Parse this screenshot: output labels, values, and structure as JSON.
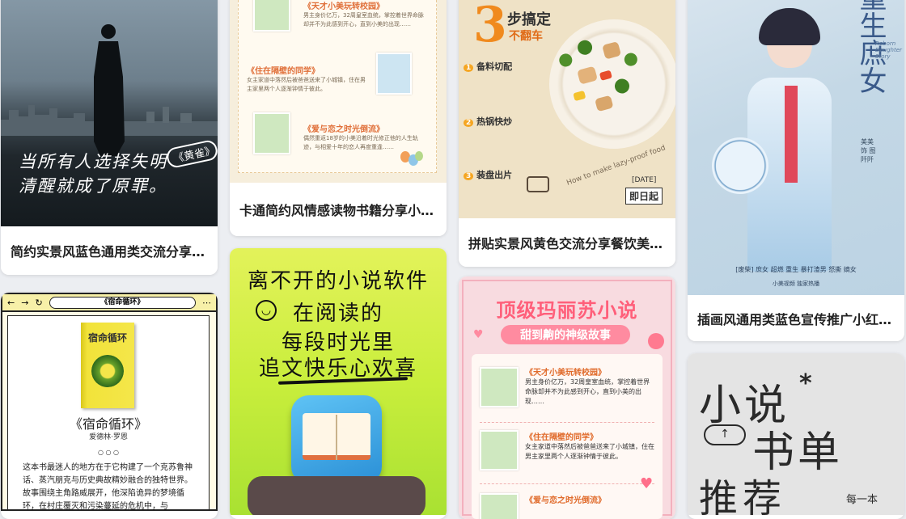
{
  "cards": [
    {
      "caption": "简约实景风蓝色通用类交流分享小红书配图",
      "overlay": {
        "line1": "当所有人选择失明",
        "line2": "清醒就成了原罪。",
        "tag": "《黄雀》"
      }
    },
    {
      "caption": "卡通简约风情感读物书籍分享小红书配图",
      "items": [
        {
          "title": "《天才小美玩转校园》",
          "text": "男主身价亿万，32周皇室血统，掌控着世界命脉却并不为此感到开心，直到小美的出现……"
        },
        {
          "title": "《住在隔壁的同学》",
          "text": "女主家道中落然后被爸爸送来了小城镇，住在男主家里两个人逐渐钟情于彼此。"
        },
        {
          "title": "《爱与恋之时光倒流》",
          "text": "偶然重返18岁的小美沿着时光修正他的人生轨迹，与相爱十年的恋人再度重逢……"
        }
      ]
    },
    {
      "caption": "拼贴实景风黄色交流分享餐饮美食小红书配图",
      "overlay": {
        "num": "3",
        "head1": "步搞定",
        "head2": "不翻车",
        "step1": "备料切配",
        "step2": "热锅快炒",
        "step3": "装盘出片",
        "circle": "How to make lazy-proof food",
        "date": "[DATE]",
        "daily": "即日起"
      }
    },
    {
      "caption": "插画风通用类蓝色宣传推广小红书配图",
      "overlay": {
        "title": "重生庶女",
        "en": "Reborn Daughter Story",
        "cast": "美美 饰 图阡阡",
        "tagline": "[废柴] 庶女 超燃 重生 暴打渣男 怒撕 嫡女",
        "credit": "小美视频 独家热播"
      }
    },
    {
      "caption": "",
      "browser": {
        "url": "《宿命循环》"
      },
      "book": {
        "cover": "宿命循环",
        "title": "《宿命循环》",
        "author": "爱德林·罗恩",
        "dots": "○ ○ ○",
        "desc": "这本书最迷人的地方在于它构建了一个克苏鲁神话、蒸汽朋克与历史典故精妙融合的独特世界。故事围绕主角路威展开，他深陷诡异的梦境循环，在村庄覆灭和污染蔓延的危机中，与"
      }
    },
    {
      "caption": "",
      "lines": [
        "离不开的小说软件",
        "在阅读的",
        "每段时光里",
        "追文快乐心欢喜"
      ]
    },
    {
      "caption": "",
      "title": "顶级玛丽苏小说",
      "subtitle": "甜到齁的神级故事",
      "items": [
        {
          "title": "《天才小美玩转校园》",
          "text": "男主身价亿万，32周皇室血统，掌控着世界命脉却并不为此感到开心，直到小美的出现……"
        },
        {
          "title": "《住在隔壁的同学》",
          "text": "女主家道中落然后被爸爸送来了小城镇，住在男主家里两个人逐渐钟情于彼此。"
        },
        {
          "title": "《爱与恋之时光倒流》",
          "text": ""
        }
      ]
    },
    {
      "caption": "",
      "title1": "小说",
      "title2": "书单",
      "title3": "推荐",
      "side": "每一本"
    }
  ]
}
